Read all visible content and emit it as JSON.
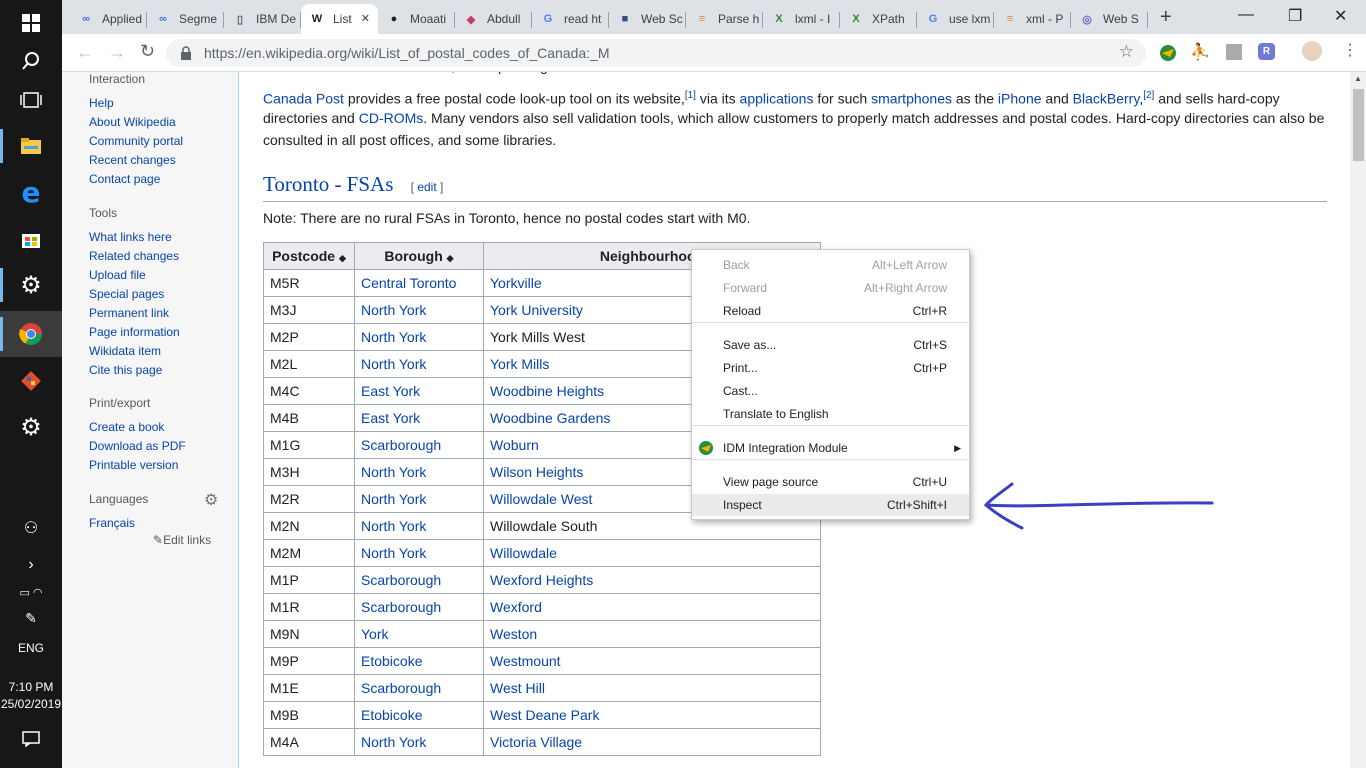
{
  "taskbar": {
    "time": "7:10 PM",
    "date": "25/02/2019",
    "language": "ENG"
  },
  "tabs": [
    {
      "label": "Applied",
      "icon": "infinity-icon"
    },
    {
      "label": "Segme",
      "icon": "infinity-icon"
    },
    {
      "label": "IBM De",
      "icon": "document-icon"
    },
    {
      "label": "List",
      "icon": "wikipedia-icon",
      "active": true
    },
    {
      "label": "Moaati",
      "icon": "github-icon"
    },
    {
      "label": "Abdull",
      "icon": "stack-icon"
    },
    {
      "label": "read ht",
      "icon": "google-icon"
    },
    {
      "label": "Web Sc",
      "icon": "site-icon"
    },
    {
      "label": "Parse h",
      "icon": "stackoverflow-icon"
    },
    {
      "label": "lxml - I",
      "icon": "x-icon"
    },
    {
      "label": "XPath",
      "icon": "x-icon"
    },
    {
      "label": "use lxm",
      "icon": "google-icon"
    },
    {
      "label": "xml - P",
      "icon": "stackoverflow-icon"
    },
    {
      "label": "Web S",
      "icon": "circle-icon"
    }
  ],
  "tab_strip": {
    "new_tab": "+"
  },
  "window": {
    "minimize": "—",
    "maximize": "❐",
    "close": "✕"
  },
  "address": {
    "url_host": "https://en.wikipedia.org",
    "url_path": "/wiki/List_of_postal_codes_of_Canada:_M"
  },
  "sidebar": {
    "sections": [
      {
        "heading": "Interaction",
        "links": [
          "Help",
          "About Wikipedia",
          "Community portal",
          "Recent changes",
          "Contact page"
        ]
      },
      {
        "heading": "Tools",
        "links": [
          "What links here",
          "Related changes",
          "Upload file",
          "Special pages",
          "Permanent link",
          "Page information",
          "Wikidata item",
          "Cite this page"
        ]
      },
      {
        "heading": "Print/export",
        "links": [
          "Create a book",
          "Download as PDF",
          "Printable version"
        ]
      },
      {
        "heading": "Languages",
        "links": [
          "Français"
        ]
      }
    ],
    "edit_links": "Edit links"
  },
  "article": {
    "para1_parts": [
      "Canada Post",
      " provides a free postal code look-up tool on its website,",
      "[1]",
      " via its ",
      "applications",
      " for such ",
      "smartphones",
      " as the ",
      "iPhone",
      " and ",
      "BlackBerry",
      ",",
      "[2]",
      " and sells hard-copy"
    ],
    "para2_parts": [
      "directories and ",
      "CD-ROMs",
      ". Many vendors also sell validation tools, which allow customers to properly match addresses and postal codes. Hard-copy directories can also be"
    ],
    "para3": "consulted in all post offices, and some libraries.",
    "heading": "Toronto - FSAs",
    "edit_label": "edit",
    "note": "Note: There are no rural FSAs in Toronto, hence no postal codes start with M0.",
    "table_headers": [
      "Postcode",
      "Borough",
      "Neighbourhood"
    ],
    "rows": [
      [
        "M5R",
        "Central Toronto",
        "Yorkville"
      ],
      [
        "M3J",
        "North York",
        "York University"
      ],
      [
        "M2P",
        "North York",
        "York Mills West"
      ],
      [
        "M2L",
        "North York",
        "York Mills"
      ],
      [
        "M4C",
        "East York",
        "Woodbine Heights"
      ],
      [
        "M4B",
        "East York",
        "Woodbine Gardens"
      ],
      [
        "M1G",
        "Scarborough",
        "Woburn"
      ],
      [
        "M3H",
        "North York",
        "Wilson Heights"
      ],
      [
        "M2R",
        "North York",
        "Willowdale West"
      ],
      [
        "M2N",
        "North York",
        "Willowdale South"
      ],
      [
        "M2M",
        "North York",
        "Willowdale"
      ],
      [
        "M1P",
        "Scarborough",
        "Wexford Heights"
      ],
      [
        "M1R",
        "Scarborough",
        "Wexford"
      ],
      [
        "M9N",
        "York",
        "Weston"
      ],
      [
        "M9P",
        "Etobicoke",
        "Westmount"
      ],
      [
        "M1E",
        "Scarborough",
        "West Hill"
      ],
      [
        "M9B",
        "Etobicoke",
        "West Deane Park"
      ],
      [
        "M4A",
        "North York",
        "Victoria Village"
      ]
    ],
    "unlinked_neighbourhoods": [
      "York Mills West",
      "Willowdale South"
    ]
  },
  "context_menu": {
    "items": [
      {
        "label": "Back",
        "shortcut": "Alt+Left Arrow",
        "disabled": true
      },
      {
        "label": "Forward",
        "shortcut": "Alt+Right Arrow",
        "disabled": true
      },
      {
        "label": "Reload",
        "shortcut": "Ctrl+R"
      },
      {
        "label": "Save as...",
        "shortcut": "Ctrl+S"
      },
      {
        "label": "Print...",
        "shortcut": "Ctrl+P"
      },
      {
        "label": "Cast...",
        "shortcut": ""
      },
      {
        "label": "Translate to English",
        "shortcut": ""
      },
      {
        "label": "IDM Integration Module",
        "shortcut": "▶"
      },
      {
        "label": "View page source",
        "shortcut": "Ctrl+U"
      },
      {
        "label": "Inspect",
        "shortcut": "Ctrl+Shift+I",
        "highlighted": true
      }
    ]
  },
  "colors": {
    "link": "#0645ad",
    "annotation_arrow": "#3b3fc4",
    "taskbar": "#171717"
  }
}
